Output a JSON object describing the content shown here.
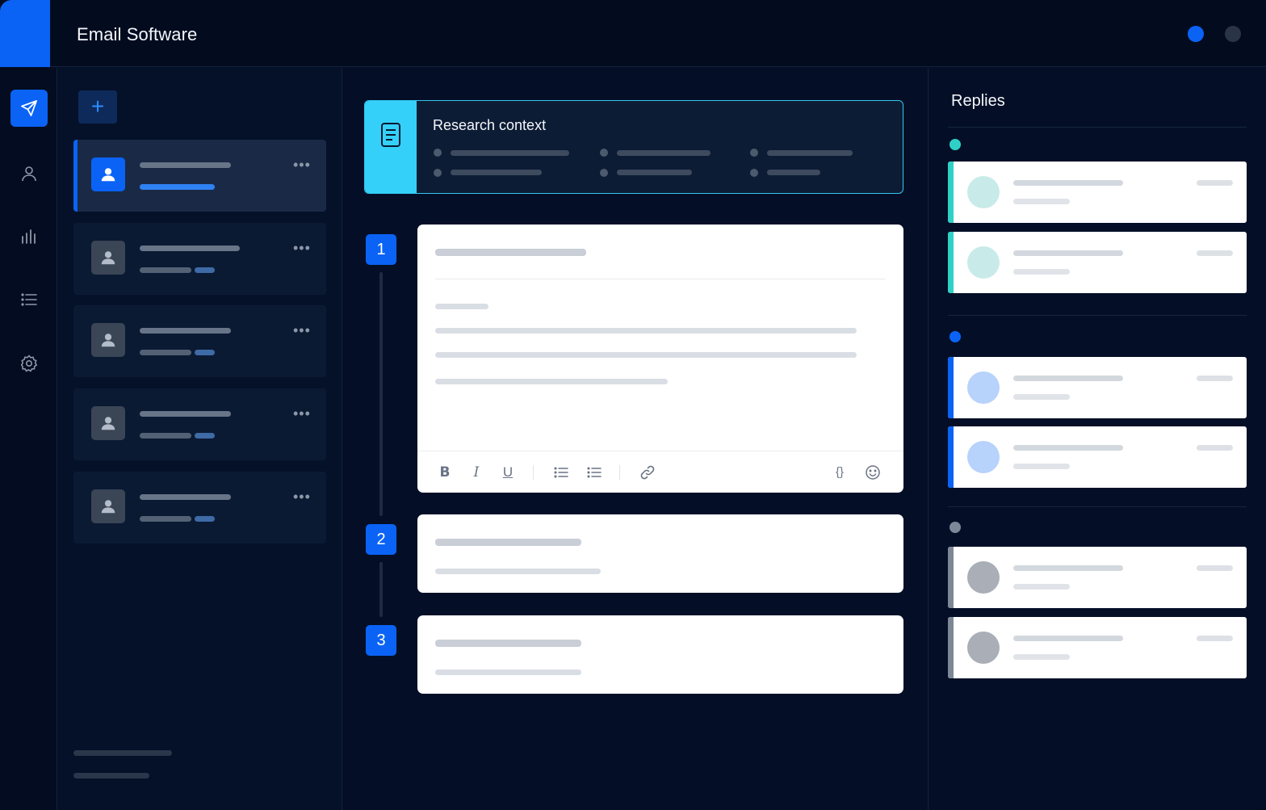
{
  "app": {
    "title": "Email Software"
  },
  "colors": {
    "accent": "#0b63f6",
    "cyan": "#34d0fa",
    "teal": "#2fd1c7",
    "grey": "#7d8798",
    "background": "#040f25"
  },
  "window_controls": [
    "blue-dot",
    "grey-dot"
  ],
  "nav": {
    "items": [
      {
        "name": "send-icon",
        "active": true
      },
      {
        "name": "user-icon",
        "active": false
      },
      {
        "name": "bar-chart-icon",
        "active": false
      },
      {
        "name": "list-icon",
        "active": false
      },
      {
        "name": "gear-icon",
        "active": false
      }
    ]
  },
  "sequences": {
    "add_label": "+",
    "more_label": "•••",
    "items": [
      {
        "active": true
      },
      {
        "active": false
      },
      {
        "active": false
      },
      {
        "active": false
      },
      {
        "active": false
      }
    ]
  },
  "research": {
    "title": "Research context",
    "icon": "document-icon"
  },
  "steps": [
    {
      "number": "1",
      "expanded": true
    },
    {
      "number": "2",
      "expanded": false
    },
    {
      "number": "3",
      "expanded": false
    }
  ],
  "editor_toolbar": {
    "bold": "B",
    "italic": "I",
    "underline": "U",
    "variables": "{}",
    "icons": [
      "bold-icon",
      "italic-icon",
      "underline-icon",
      "bulleted-list-icon",
      "numbered-list-icon",
      "link-icon",
      "variables-icon",
      "emoji-icon"
    ]
  },
  "replies": {
    "title": "Replies",
    "groups": [
      {
        "color": "#2fd1c7",
        "count": 2
      },
      {
        "color": "#0b63f6",
        "count": 2
      },
      {
        "color": "#7d8798",
        "count": 2
      }
    ]
  }
}
